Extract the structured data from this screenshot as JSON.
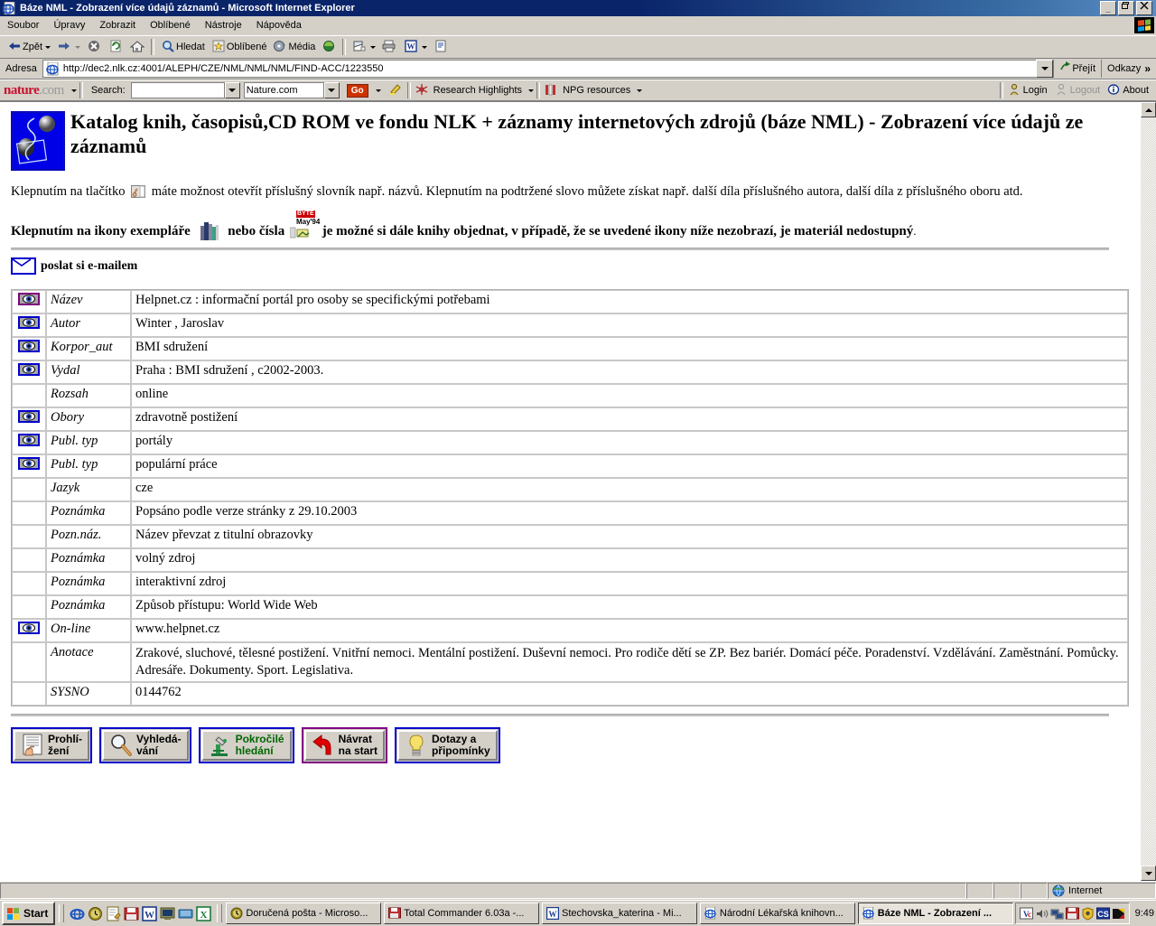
{
  "window": {
    "title": "Báze NML - Zobrazení více údajů záznamů - Microsoft Internet Explorer",
    "minimize": "_",
    "restore": "❐",
    "close": "X"
  },
  "menu": [
    "Soubor",
    "Úpravy",
    "Zobrazit",
    "Oblíbené",
    "Nástroje",
    "Nápověda"
  ],
  "toolbar": {
    "back": "Zpět",
    "forward": "",
    "stop": "",
    "refresh": "",
    "home": "",
    "search": "Hledat",
    "favorites": "Oblíbené",
    "media": "Média",
    "history": "",
    "mail": "",
    "print": "",
    "edit": "",
    "discuss": ""
  },
  "address": {
    "label": "Adresa",
    "url": "http://dec2.nlk.cz:4001/ALEPH/CZE/NML/NML/NML/FIND-ACC/1223550",
    "go": "Přejít",
    "links": "Odkazy",
    "chevron": "»"
  },
  "naturebar": {
    "logo_1": "nature",
    "logo_2": ".com",
    "search_label": "Search:",
    "search_value": "",
    "scope_value": "Nature.com",
    "go": "Go",
    "highlights": "Research Highlights",
    "npg": "NPG resources",
    "login": "Login",
    "logout": "Logout",
    "about": "About"
  },
  "page": {
    "heading": "Katalog knih, časopisů,CD ROM ve fondu NLK + záznamy internetových zdrojů (báze NML) - Zobrazení více údajů ze záznamů",
    "intro_a": "Klepnutím na tlačítko",
    "intro_b": "máte možnost otevřít příslušný slovník např. názvů. Klepnutím na podtržené slovo můžete získat např. další díla příslušného autora, další díla z příslušného oboru atd.",
    "intro2_a": "Klepnutím na ikony exempláře",
    "intro2_b": "nebo čísla",
    "intro2_c": "je možné si dále knihy objednat, v případě, že se uvedené ikony níže nezobrazí, je materiál nedostupný",
    "intro2_d": ".",
    "byte_top": "BYTE",
    "byte_bottom": "May'94",
    "mail_link": "poslat si e-mailem"
  },
  "record": {
    "rows": [
      {
        "icon": "eye-visited",
        "label": "Název",
        "value": "Helpnet.cz : informační portál pro osoby se specifickými potřebami"
      },
      {
        "icon": "eye",
        "label": "Autor",
        "value": "Winter , Jaroslav"
      },
      {
        "icon": "eye",
        "label": "Korpor_aut",
        "value": "BMI sdružení"
      },
      {
        "icon": "eye",
        "label": "Vydal",
        "value": "Praha : BMI sdružení , c2002-2003."
      },
      {
        "icon": "none",
        "label": "Rozsah",
        "value": "online"
      },
      {
        "icon": "eye",
        "label": "Obory",
        "value": "zdravotně postižení"
      },
      {
        "icon": "eye",
        "label": "Publ. typ",
        "value": "portály"
      },
      {
        "icon": "eye",
        "label": "Publ. typ",
        "value": "populární práce"
      },
      {
        "icon": "none",
        "label": "Jazyk",
        "value": "cze"
      },
      {
        "icon": "none",
        "label": "Poznámka",
        "value": "Popsáno podle verze stránky z 29.10.2003"
      },
      {
        "icon": "none",
        "label": "Pozn.náz.",
        "value": "Název převzat z titulní obrazovky"
      },
      {
        "icon": "none",
        "label": "Poznámka",
        "value": "volný zdroj"
      },
      {
        "icon": "none",
        "label": "Poznámka",
        "value": "interaktivní zdroj"
      },
      {
        "icon": "none",
        "label": "Poznámka",
        "value": "Způsob přístupu: World Wide Web"
      },
      {
        "icon": "eye-gray",
        "label": "On-line",
        "value": "www.helpnet.cz"
      },
      {
        "icon": "none",
        "label": "Anotace",
        "value": "Zrakové, sluchové, tělesné postižení. Vnitřní nemoci. Mentální postižení. Duševní nemoci. Pro rodiče dětí se ZP. Bez bariér. Domácí péče. Poradenství. Vzdělávání. Zaměstnání. Pomůcky. Adresáře. Dokumenty. Sport. Legislativa."
      },
      {
        "icon": "none",
        "label": "SYSNO",
        "value": "0144762"
      }
    ]
  },
  "navbuttons": [
    {
      "icon": "hand-list-icon",
      "line1": "Prohlí-",
      "line2": "žení",
      "border": "#0000cc",
      "color": "#000000"
    },
    {
      "icon": "magnifier-icon",
      "line1": "Vyhledá-",
      "line2": "vání",
      "border": "#0000cc",
      "color": "#000000"
    },
    {
      "icon": "microscope-icon",
      "line1": "Pokročilé",
      "line2": "hledání",
      "border": "#0000cc",
      "color": "#006600"
    },
    {
      "icon": "back-arrow-icon",
      "line1": "Návrat",
      "line2": "na start",
      "border": "#800080",
      "color": "#000000"
    },
    {
      "icon": "bulb-icon",
      "line1": "Dotazy a",
      "line2": "připomínky",
      "border": "#0000cc",
      "color": "#000000"
    }
  ],
  "statusbar": {
    "message": "",
    "zone": "Internet"
  },
  "taskbar": {
    "start": "Start",
    "quicklaunch": [
      "ie-icon",
      "clock-icon",
      "notepad-icon",
      "save-icon",
      "word-icon",
      "terminal-icon",
      "keyboard-icon",
      "excel-icon"
    ],
    "tasks": [
      {
        "icon": "outlook-icon",
        "label": "Doručená pošta - Microso...",
        "active": false
      },
      {
        "icon": "save-icon",
        "label": "Total Commander 6.03a -...",
        "active": false
      },
      {
        "icon": "word-icon",
        "label": "Stechovska_katerina - Mi...",
        "active": false
      },
      {
        "icon": "ie-icon",
        "label": "Národní Lékařská knihovn...",
        "active": false
      },
      {
        "icon": "ie-icon",
        "label": "Báze NML - Zobrazení ...",
        "active": true
      }
    ],
    "tray": [
      "vc-icon",
      "volume-icon",
      "network-icon",
      "save-icon",
      "shield-icon",
      "cs-icon",
      "flag-icon"
    ],
    "clock": "9:49"
  },
  "colors": {
    "title_bar": "#0a246a",
    "face": "#d4d0c8",
    "link_blue": "#0000cc",
    "link_visited": "#800080",
    "nature_red": "#c8102e",
    "green_label": "#006600"
  }
}
